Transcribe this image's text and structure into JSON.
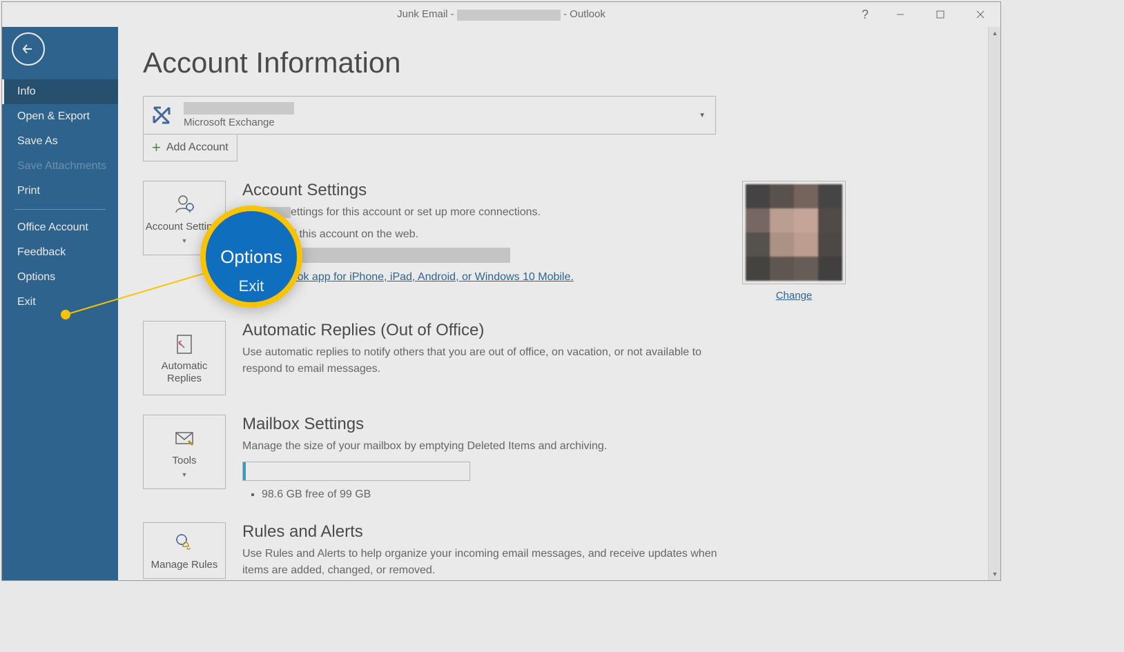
{
  "titlebar": {
    "prefix": "Junk Email - ",
    "suffix": " -  Outlook"
  },
  "sidebar": {
    "items": [
      {
        "label": "Info",
        "selected": true
      },
      {
        "label": "Open & Export"
      },
      {
        "label": "Save As"
      },
      {
        "label": "Save Attachments",
        "disabled": true
      },
      {
        "label": "Print"
      },
      {
        "sep": true
      },
      {
        "label": "Office Account"
      },
      {
        "label": "Feedback"
      },
      {
        "label": "Options"
      },
      {
        "label": "Exit"
      }
    ]
  },
  "page": {
    "title": "Account Information",
    "account_type": "Microsoft Exchange",
    "add_account": "Add Account"
  },
  "settings": {
    "tile": "Account Settings",
    "title": "Account Settings",
    "line1a": "ettings for this account or set up more connections.",
    "line2a": "this account on the web.",
    "link": "e Outlook app for iPhone, iPad, Android, or Windows 10 Mobile.",
    "change": "Change"
  },
  "auto": {
    "tile": "Automatic Replies",
    "title": "Automatic Replies (Out of Office)",
    "desc": "Use automatic replies to notify others that you are out of office, on vacation, or not available to respond to email messages."
  },
  "mailbox": {
    "tile": "Tools",
    "title": "Mailbox Settings",
    "desc": "Manage the size of your mailbox by emptying Deleted Items and archiving.",
    "quota": "98.6 GB free of 99 GB"
  },
  "rules": {
    "tile": "Manage Rules",
    "title": "Rules and Alerts",
    "desc": "Use Rules and Alerts to help organize your incoming email messages, and receive updates when items are added, changed, or removed."
  },
  "callout": {
    "above": "",
    "main": "Options",
    "below": "Exit"
  },
  "pix_colors": [
    "#2c2a2a",
    "#463b36",
    "#685449",
    "#2e2c2c",
    "#6b5851",
    "#c39e8f",
    "#cfa796",
    "#3b342f",
    "#413b36",
    "#b08d7e",
    "#c49d8b",
    "#34302d",
    "#2b2926",
    "#4d423b",
    "#574b42",
    "#272524"
  ]
}
